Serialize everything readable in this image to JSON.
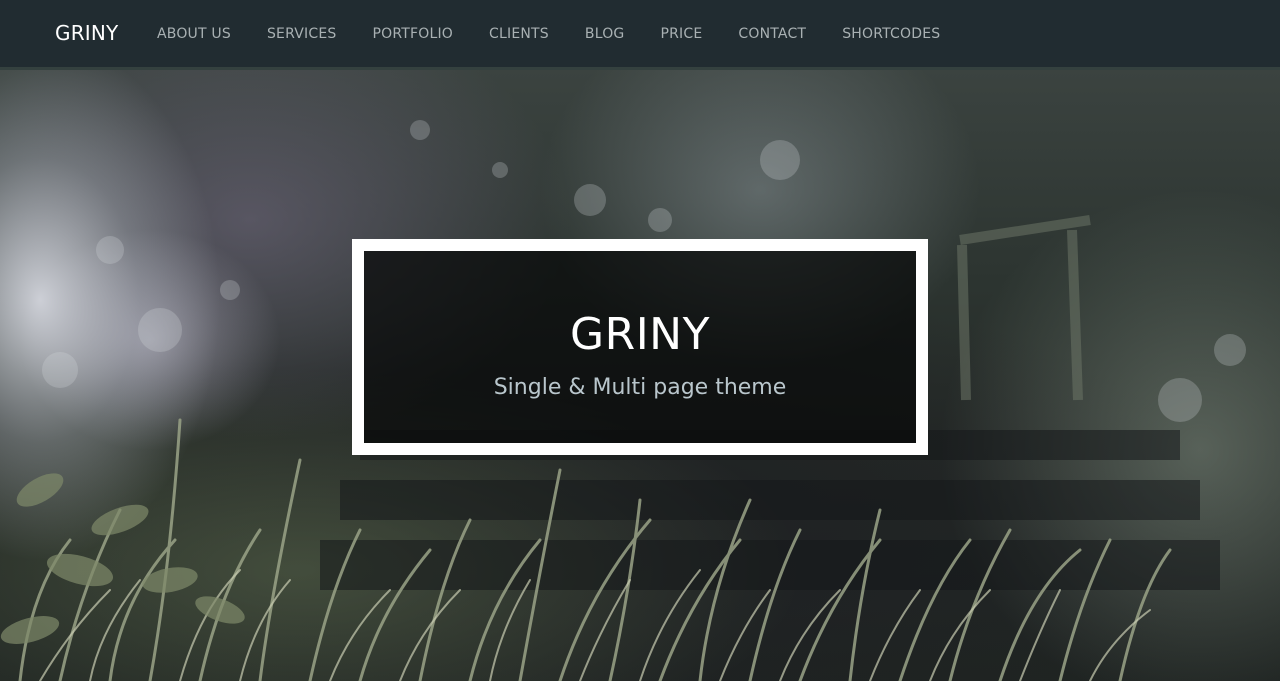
{
  "navbar": {
    "brand": "GRINY",
    "items": [
      {
        "label": "ABOUT US"
      },
      {
        "label": "SERVICES"
      },
      {
        "label": "PORTFOLIO"
      },
      {
        "label": "CLIENTS"
      },
      {
        "label": "BLOG"
      },
      {
        "label": "PRICE"
      },
      {
        "label": "CONTACT"
      },
      {
        "label": "SHORTCODES"
      }
    ]
  },
  "hero": {
    "title": "GRINY",
    "subtitle": "Single & Multi page theme"
  },
  "colors": {
    "navbar_bg": "#212c31",
    "nav_text": "#a9b1b3",
    "brand_text": "#ffffff",
    "frame_border": "#ffffff",
    "subtitle_text": "#b9c6cc"
  }
}
